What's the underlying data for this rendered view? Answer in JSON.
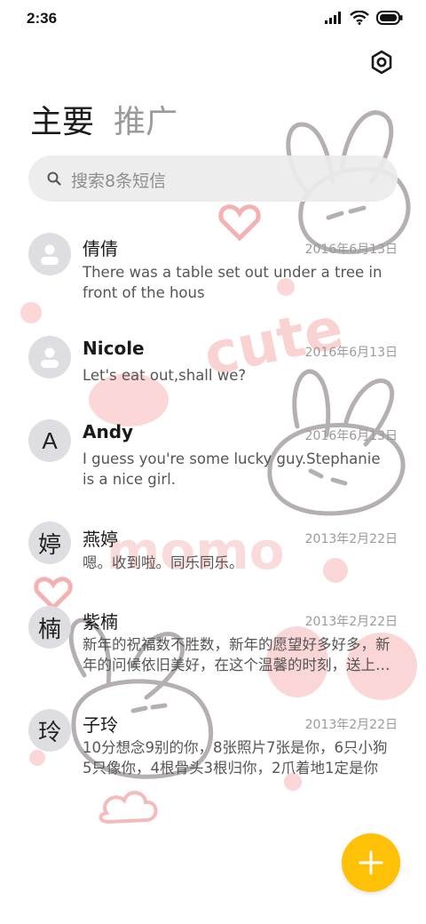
{
  "status": {
    "time": "2:36"
  },
  "tabs": [
    {
      "label": "主要",
      "active": true
    },
    {
      "label": "推广",
      "active": false
    }
  ],
  "search": {
    "placeholder": "搜索8条短信"
  },
  "conversations": [
    {
      "avatar_type": "person",
      "avatar_text": "",
      "name": "倩倩",
      "date": "2016年6月13日",
      "preview": "There was a table set out under a tree in front of the hous"
    },
    {
      "avatar_type": "person",
      "avatar_text": "",
      "name": "Nicole",
      "date": "2016年6月13日",
      "preview": "Let's eat out,shall we?"
    },
    {
      "avatar_type": "letter",
      "avatar_text": "A",
      "name": "Andy",
      "date": "2016年6月13日",
      "preview": "I guess you're some lucky guy.Stephanie is a nice girl."
    },
    {
      "avatar_type": "letter",
      "avatar_text": "婷",
      "name": "燕婷",
      "date": "2013年2月22日",
      "preview": "嗯。收到啦。同乐同乐。"
    },
    {
      "avatar_type": "letter",
      "avatar_text": "楠",
      "name": "紫楠",
      "date": "2013年2月22日",
      "preview": "新年的祝福数不胜数，新年的愿望好多好多，新年的问候依旧美好，在这个温馨的时刻，送上我最真挚的祝福"
    },
    {
      "avatar_type": "letter",
      "avatar_text": "玲",
      "name": "子玲",
      "date": "2013年2月22日",
      "preview": "10分想念9别的你，8张照片7张是你，6只小狗5只像你，4根骨头3根归你，2爪着地1定是你"
    }
  ],
  "decorations": {
    "text_cute": "cute",
    "text_momo": "momo"
  },
  "colors": {
    "fab": "#ffc107",
    "decor_pink": "#f7b9b9",
    "decor_gray": "#a9a2a2"
  },
  "icons": {
    "settings": "settings-icon",
    "search": "search-icon",
    "compose": "plus-icon"
  }
}
